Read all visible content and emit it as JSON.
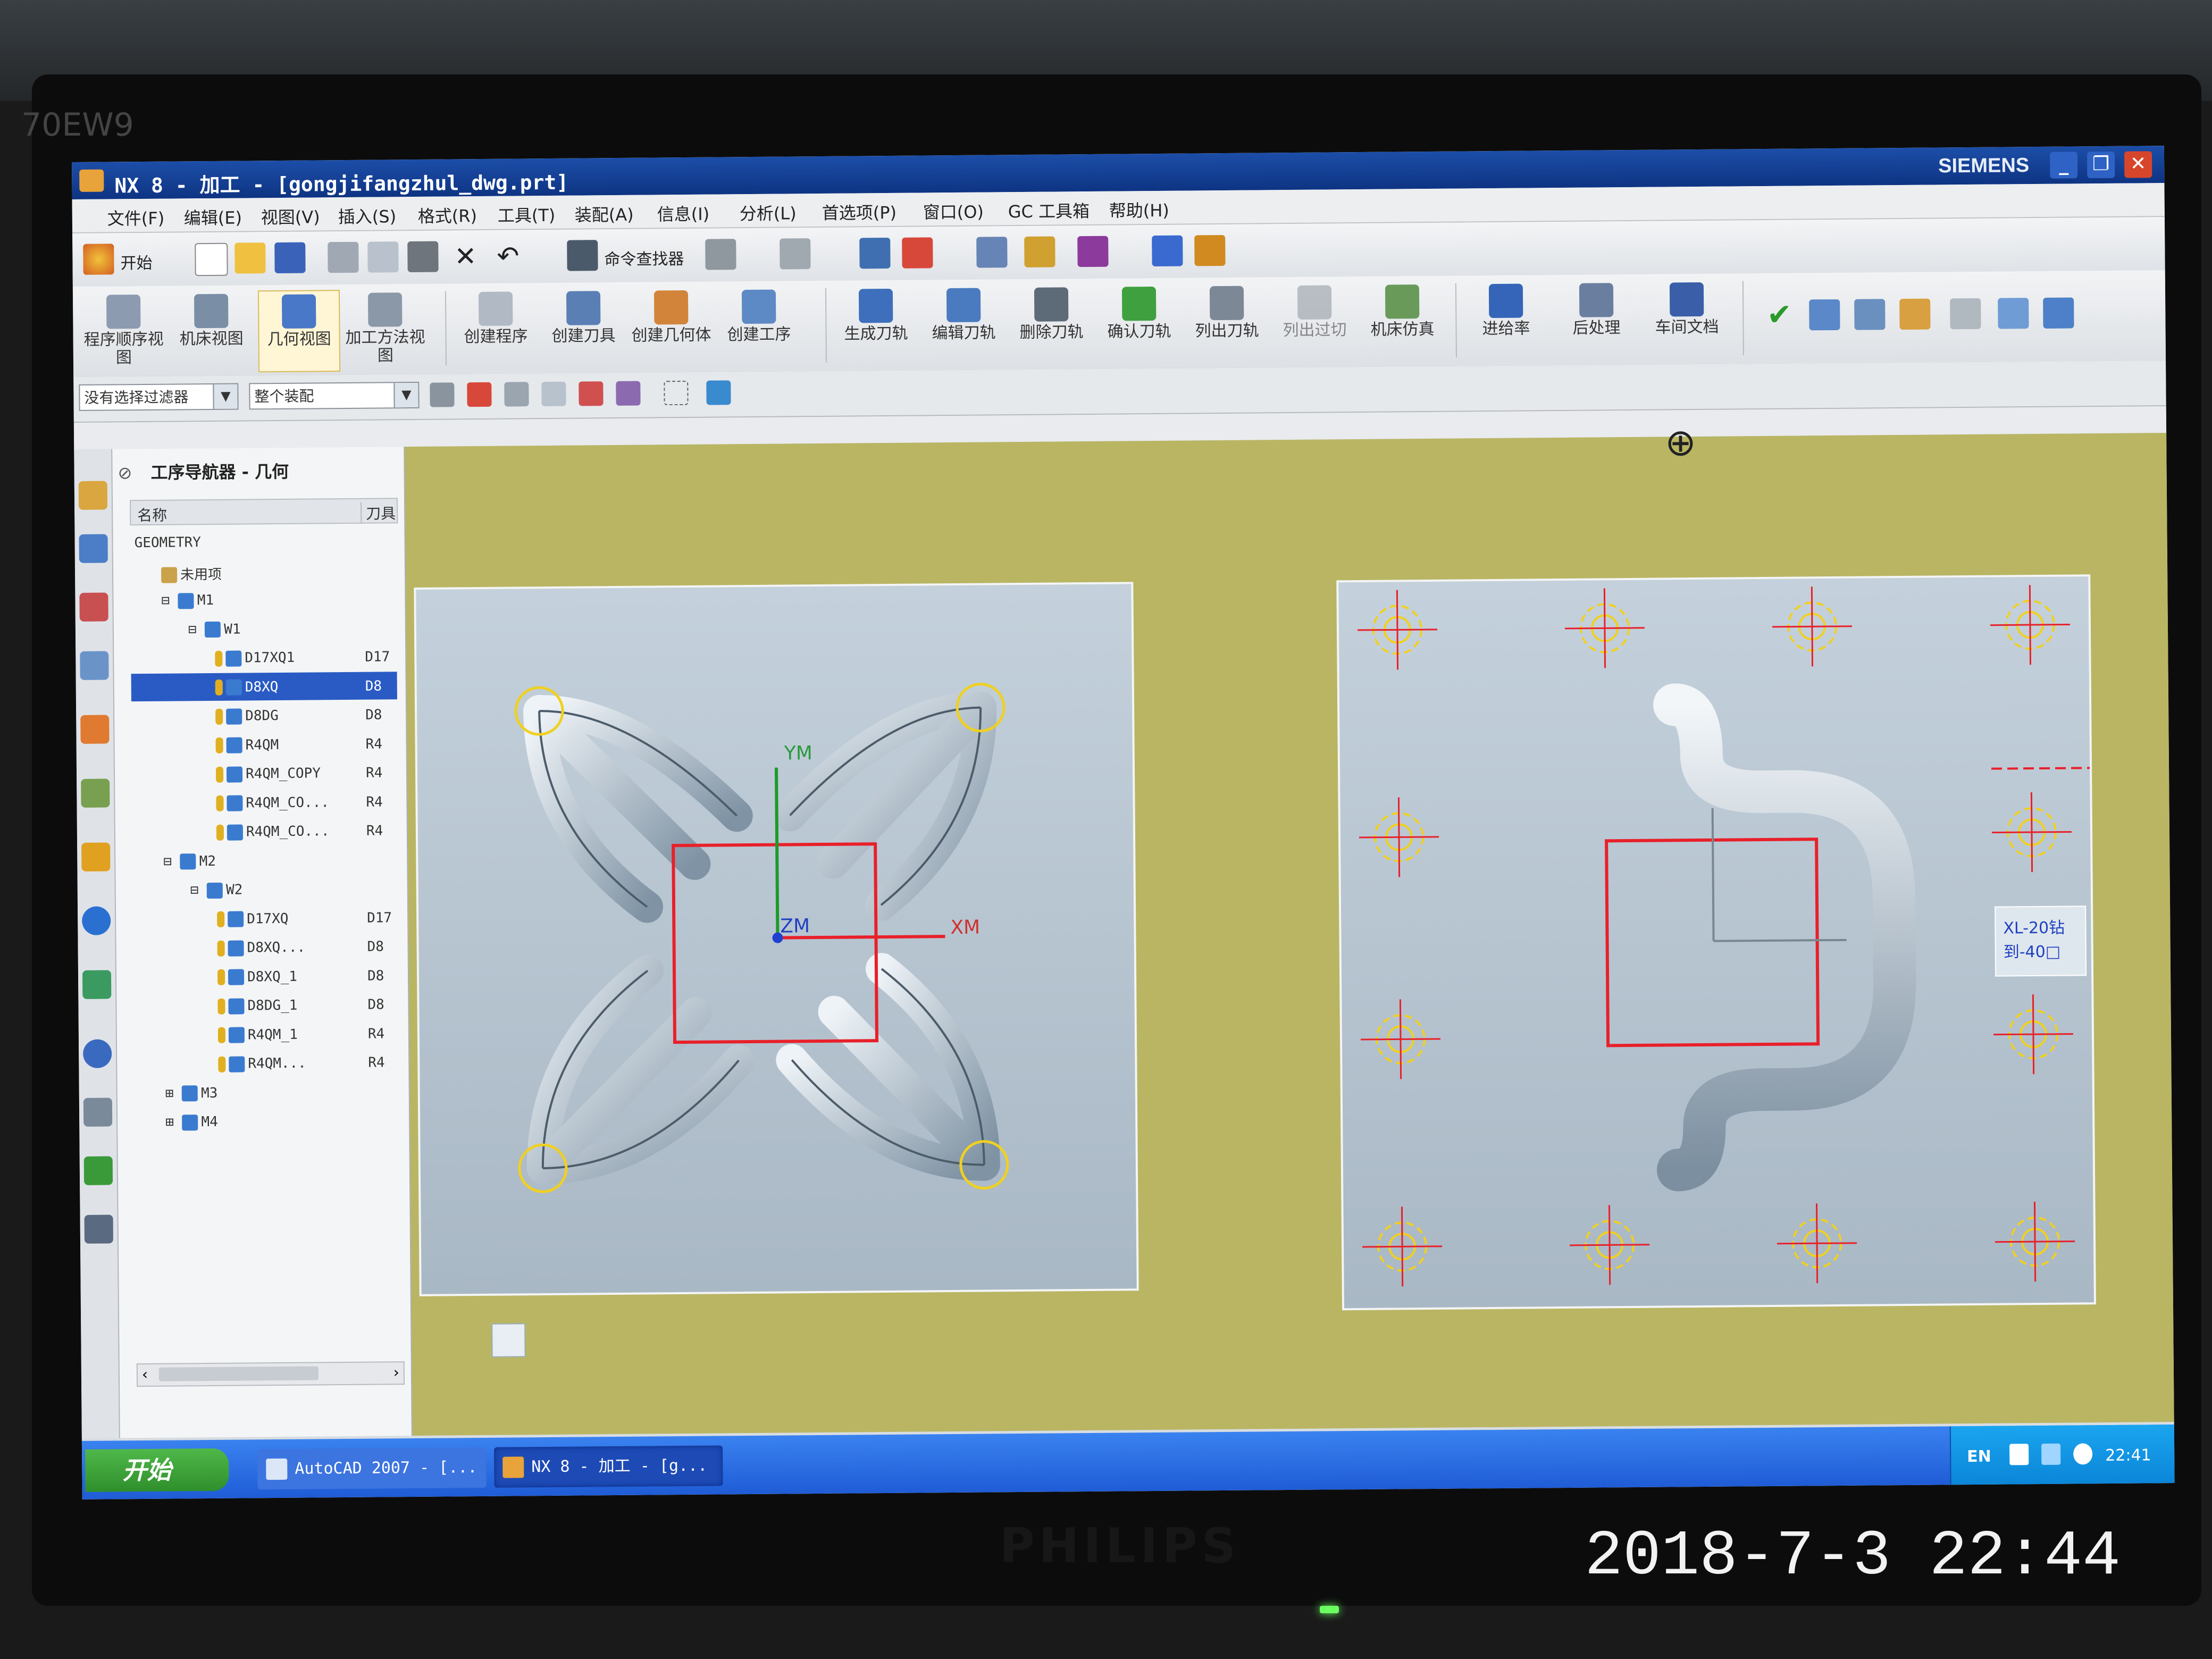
{
  "photo": {
    "monitor_model": "70EW9",
    "monitor_brand": "PHILIPS",
    "timestamp": "2018-7-3 22:44"
  },
  "window": {
    "title": "NX 8 - 加工 - [gongjifangzhul_dwg.prt]",
    "vendor": "SIEMENS",
    "buttons": [
      "_",
      "❐",
      "✕"
    ]
  },
  "menubar": {
    "items": [
      "文件(F)",
      "编辑(E)",
      "视图(V)",
      "插入(S)",
      "格式(R)",
      "工具(T)",
      "装配(A)",
      "信息(I)",
      "分析(L)",
      "首选项(P)",
      "窗口(O)",
      "GC 工具箱",
      "帮助(H)"
    ]
  },
  "toolbar1": {
    "start_label": "开始",
    "command_finder": "命令查找器"
  },
  "toolbar2": {
    "view_buttons": [
      {
        "label": "程序顺序视图",
        "icon": "program-order-icon"
      },
      {
        "label": "机床视图",
        "icon": "machine-view-icon"
      },
      {
        "label": "几何视图",
        "icon": "geometry-view-icon",
        "active": true
      },
      {
        "label": "加工方法视图",
        "icon": "method-view-icon"
      }
    ],
    "create_buttons": [
      {
        "label": "创建程序",
        "icon": "create-program-icon"
      },
      {
        "label": "创建刀具",
        "icon": "create-tool-icon"
      },
      {
        "label": "创建几何体",
        "icon": "create-geometry-icon"
      },
      {
        "label": "创建工序",
        "icon": "create-operation-icon"
      }
    ],
    "op_buttons": [
      {
        "label": "生成刀轨",
        "icon": "generate-toolpath-icon"
      },
      {
        "label": "编辑刀轨",
        "icon": "edit-toolpath-icon"
      },
      {
        "label": "删除刀轨",
        "icon": "delete-toolpath-icon"
      },
      {
        "label": "确认刀轨",
        "icon": "verify-toolpath-icon"
      },
      {
        "label": "列出刀轨",
        "icon": "list-toolpath-icon"
      },
      {
        "label": "列出过切",
        "icon": "list-gouge-icon"
      },
      {
        "label": "机床仿真",
        "icon": "machine-sim-icon"
      }
    ],
    "misc_buttons": [
      {
        "label": "进给率",
        "icon": "feed-rate-icon"
      },
      {
        "label": "后处理",
        "icon": "postprocess-icon"
      },
      {
        "label": "车间文档",
        "icon": "shop-doc-icon"
      }
    ]
  },
  "toolbar3": {
    "filter_value": "没有选择过滤器",
    "assembly_value": "整个装配"
  },
  "navigator": {
    "title": "工序导航器 - 几何",
    "col_name": "名称",
    "col_tool": "刀具",
    "rows": [
      {
        "name": "GEOMETRY",
        "tool": "",
        "indent": 0,
        "kind": "root"
      },
      {
        "name": "未用项",
        "tool": "",
        "indent": 1,
        "kind": "folder"
      },
      {
        "name": "M1",
        "tool": "",
        "indent": 1,
        "kind": "mcs",
        "toggle": "⊟"
      },
      {
        "name": "W1",
        "tool": "",
        "indent": 2,
        "kind": "workpiece",
        "toggle": "⊟"
      },
      {
        "name": "D17XQ1",
        "tool": "D17",
        "indent": 3,
        "kind": "op"
      },
      {
        "name": "D8XQ",
        "tool": "D8",
        "indent": 3,
        "kind": "op",
        "selected": true
      },
      {
        "name": "D8DG",
        "tool": "D8",
        "indent": 3,
        "kind": "op"
      },
      {
        "name": "R4QM",
        "tool": "R4",
        "indent": 3,
        "kind": "op"
      },
      {
        "name": "R4QM_COPY",
        "tool": "R4",
        "indent": 3,
        "kind": "op"
      },
      {
        "name": "R4QM_CO...",
        "tool": "R4",
        "indent": 3,
        "kind": "op"
      },
      {
        "name": "R4QM_CO...",
        "tool": "R4",
        "indent": 3,
        "kind": "op"
      },
      {
        "name": "M2",
        "tool": "",
        "indent": 1,
        "kind": "mcs",
        "toggle": "⊟"
      },
      {
        "name": "W2",
        "tool": "",
        "indent": 2,
        "kind": "workpiece",
        "toggle": "⊟"
      },
      {
        "name": "D17XQ",
        "tool": "D17",
        "indent": 3,
        "kind": "op"
      },
      {
        "name": "D8XQ...",
        "tool": "D8",
        "indent": 3,
        "kind": "op"
      },
      {
        "name": "D8XQ_1",
        "tool": "D8",
        "indent": 3,
        "kind": "op"
      },
      {
        "name": "D8DG_1",
        "tool": "D8",
        "indent": 3,
        "kind": "op"
      },
      {
        "name": "R4QM_1",
        "tool": "R4",
        "indent": 3,
        "kind": "op"
      },
      {
        "name": "R4QM...",
        "tool": "R4",
        "indent": 3,
        "kind": "op"
      },
      {
        "name": "M3",
        "tool": "",
        "indent": 1,
        "kind": "mcs",
        "toggle": "⊞"
      },
      {
        "name": "M4",
        "tool": "",
        "indent": 1,
        "kind": "mcs",
        "toggle": "⊞"
      }
    ]
  },
  "graphics": {
    "axis_labels": {
      "ym": "YM",
      "xm": "XM",
      "zm": "ZM"
    },
    "annotation_lines": [
      "XL-20钻",
      "到-40□"
    ],
    "colors": {
      "background": "#b9b563",
      "part": "#b6c5d1",
      "wcs_box": "#e8202a",
      "marker": "#f0d020"
    }
  },
  "taskbar": {
    "start_label": "开始",
    "tasks": [
      {
        "label": "AutoCAD 2007 - [...",
        "icon": "autocad-icon"
      },
      {
        "label": "NX 8 - 加工 - [g...",
        "icon": "nx-icon",
        "active": true
      }
    ],
    "lang": "EN",
    "time": "22:41"
  }
}
